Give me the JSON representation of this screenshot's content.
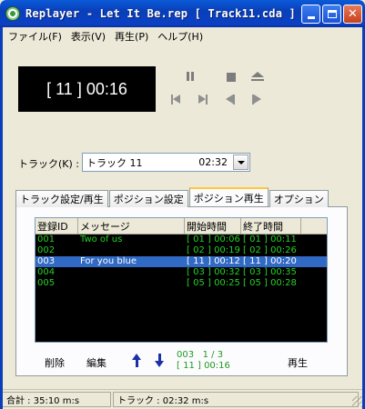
{
  "window": {
    "title": "Replayer - Let It Be.rep [ Track11.cda ]"
  },
  "menu": [
    "ファイル(F)",
    "表示(V)",
    "再生(P)",
    "ヘルプ(H)"
  ],
  "display": {
    "text": "[ 11 ] 00:16"
  },
  "track": {
    "label": "トラック(K) :",
    "name": "トラック 11",
    "duration": "02:32"
  },
  "tabs": [
    "トラック設定/再生",
    "ポジション設定",
    "ポジション再生",
    "オプション"
  ],
  "active_tab": "ポジション再生",
  "list": {
    "columns": [
      "登録ID",
      "メッセージ",
      "開始時間",
      "終了時間"
    ],
    "rows": [
      {
        "id": "001",
        "message": "Two of us",
        "start": "[ 01 ] 00:06",
        "end": "[ 01 ] 00:11"
      },
      {
        "id": "002",
        "message": "",
        "start": "[ 02 ] 00:19",
        "end": "[ 02 ] 00:26"
      },
      {
        "id": "003",
        "message": "For you blue",
        "start": "[ 11 ] 00:12",
        "end": "[ 11 ] 00:20"
      },
      {
        "id": "004",
        "message": "",
        "start": "[ 03 ] 00:32",
        "end": "[ 03 ] 00:35"
      },
      {
        "id": "005",
        "message": "",
        "start": "[ 05 ] 00:25",
        "end": "[ 05 ] 00:28"
      }
    ],
    "selected_index": 2
  },
  "panel_buttons": {
    "delete": "削除",
    "edit": "編集",
    "play": "再生"
  },
  "position_info": {
    "line1": "003   1 / 3",
    "line2": "[ 11 ] 00:16"
  },
  "status": {
    "total": "合計 : 35:10 m:s",
    "track": "トラック : 02:32 m:s"
  },
  "colors": {
    "list_text": "#25d025",
    "selection": "#316ac5",
    "title_bar": "#0a3fb9"
  }
}
